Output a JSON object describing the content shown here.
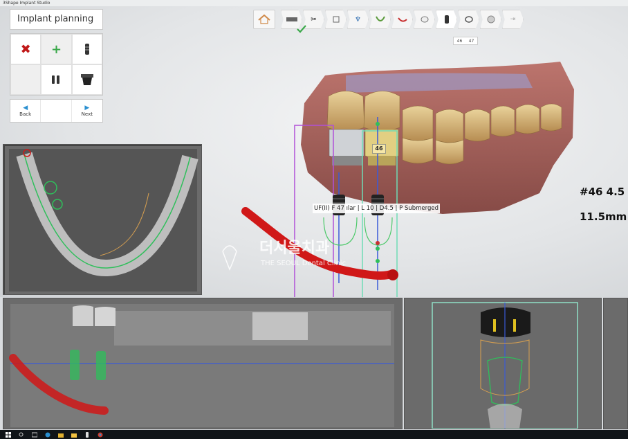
{
  "window": {
    "title": "3Shape Implant Studio"
  },
  "panel": {
    "title": "Implant planning",
    "tools": [
      {
        "name": "delete-icon"
      },
      {
        "name": "add-icon"
      },
      {
        "name": "implant-icon"
      },
      {
        "name": "empty"
      },
      {
        "name": "multi-implant-icon"
      },
      {
        "name": "abutment-icon"
      }
    ],
    "nav": {
      "back_label": "Back",
      "next_label": "Next"
    }
  },
  "workflow": {
    "steps": [
      "scan-icon",
      "tools-icon",
      "model-icon",
      "crown-icon",
      "arch-icon",
      "nerve-icon",
      "tooth-icon",
      "implant-icon",
      "sleeve-icon",
      "guide-icon",
      "finish-icon"
    ],
    "tooltip": [
      "46",
      "47"
    ]
  },
  "scene": {
    "tooth_label": "46",
    "implant_info": "UF(II) F 47 ılar | L 10 | D4.5 | P Submerged",
    "measure_lines": [
      "#46 4.5",
      "11.5mm"
    ],
    "watermark_ko": "더서울치과",
    "watermark_en": "THE SEOUL Dental Clinic"
  },
  "colors": {
    "accent": "#2a8fd0",
    "nerve": "#d01818",
    "implant": "#2fbf5b",
    "guide": "#8fe0c6"
  }
}
